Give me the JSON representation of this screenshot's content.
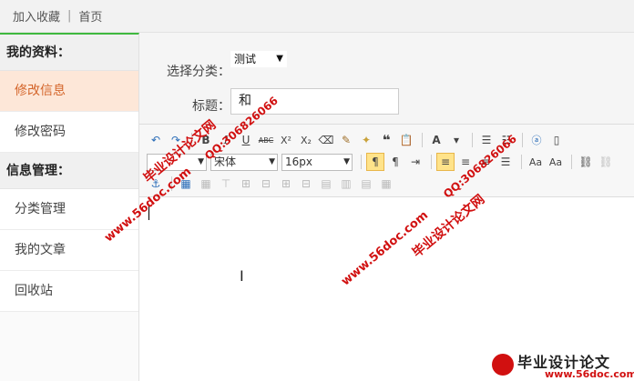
{
  "topbar": {
    "favorite": "加入收藏",
    "separator": "|",
    "home": "首页"
  },
  "sidebar": {
    "section1": "我的资料：",
    "items1": [
      "修改信息",
      "修改密码"
    ],
    "section2": "信息管理：",
    "items2": [
      "分类管理",
      "我的文章",
      "回收站"
    ]
  },
  "form": {
    "category_label": "选择分类：",
    "category_value": "测试",
    "title_label": "标题：",
    "title_value": "和"
  },
  "editor": {
    "font_family": "宋体",
    "font_size": "16px",
    "row1": [
      "undo",
      "B",
      "I",
      "U",
      "ABC",
      "X²",
      "X₂",
      "eraser",
      "brush",
      "wand",
      "quote",
      "paste",
      "A",
      "highlight",
      "ol",
      "ul",
      "a-box",
      "doc"
    ],
    "row2": [
      "ltr",
      "rtl",
      "indent",
      "align-left",
      "align-center",
      "align-right",
      "justify",
      "case-up",
      "case-down",
      "link",
      "unlink"
    ],
    "row3": [
      "anchor",
      "table",
      "insert-row",
      "insert-col",
      "merge",
      "split",
      "delete"
    ]
  },
  "watermarks": {
    "site_cn": "毕业设计论文网",
    "qq": "QQ:306826066",
    "url": "www.56doc.com"
  },
  "logo": {
    "name": "毕业设计论文",
    "url": "www.56doc.com"
  }
}
